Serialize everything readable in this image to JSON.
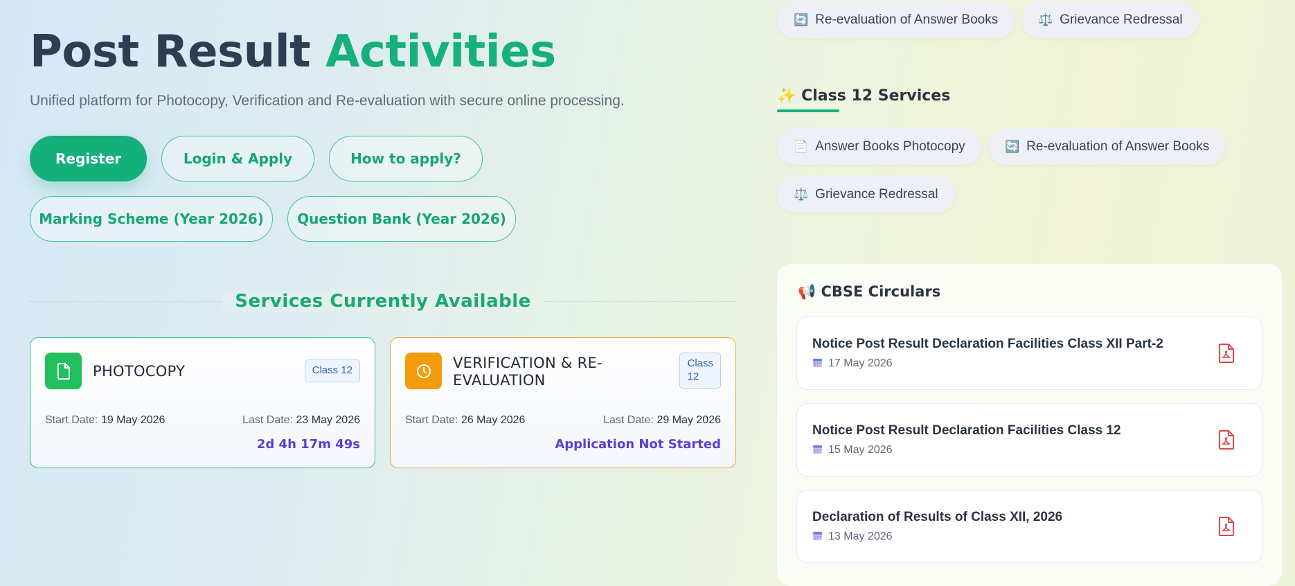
{
  "hero": {
    "title_main": "Post Result",
    "title_accent": "Activities",
    "subtitle": "Unified platform for Photocopy, Verification and Re-evaluation with secure online processing."
  },
  "actions": {
    "register": "Register",
    "login": "Login & Apply",
    "how_to": "How to apply?",
    "marking_scheme": "Marking Scheme (Year 2026)",
    "question_bank": "Question Bank (Year 2026)"
  },
  "services": {
    "heading": "Services Currently Available",
    "cards": [
      {
        "name": "PHOTOCOPY",
        "class_badge": "Class 12",
        "start_label": "Start Date:",
        "start_value": "19 May 2026",
        "last_label": "Last Date:",
        "last_value": "23 May 2026",
        "status": "2d 4h 17m 49s",
        "icon": "document-icon",
        "color": "#22c05d"
      },
      {
        "name": "VERIFICATION & RE-EVALUATION",
        "name_line1": "VERIFICATION & RE-",
        "name_line2": "EVALUATION",
        "class_badge_line1": "Class",
        "class_badge_line2": "12",
        "start_label": "Start Date:",
        "start_value": "26 May 2026",
        "last_label": "Last Date:",
        "last_value": "29 May 2026",
        "status": "Application Not Started",
        "icon": "clock-icon",
        "color": "#f29b0c"
      }
    ]
  },
  "top_chips": [
    {
      "icon": "🔄",
      "label": "Re-evaluation of Answer Books"
    },
    {
      "icon": "⚖️",
      "label": "Grievance Redressal"
    }
  ],
  "class12": {
    "icon": "✨",
    "heading": "Class 12 Services",
    "chips": [
      {
        "icon": "📄",
        "label": "Answer Books Photocopy"
      },
      {
        "icon": "🔄",
        "label": "Re-evaluation of Answer Books"
      },
      {
        "icon": "⚖️",
        "label": "Grievance Redressal"
      }
    ]
  },
  "circulars": {
    "icon": "📢",
    "heading": "CBSE Circulars",
    "items": [
      {
        "title": "Notice Post Result Declaration Facilities Class XII Part-2",
        "date": "17 May 2026"
      },
      {
        "title": "Notice Post Result Declaration Facilities Class 12",
        "date": "15 May 2026"
      },
      {
        "title": "Declaration of Results of Class XII, 2026",
        "date": "13 May 2026"
      }
    ]
  },
  "colors": {
    "accent": "#16b07b",
    "countdown": "#5a3fd0",
    "pdf": "#e0464a"
  }
}
